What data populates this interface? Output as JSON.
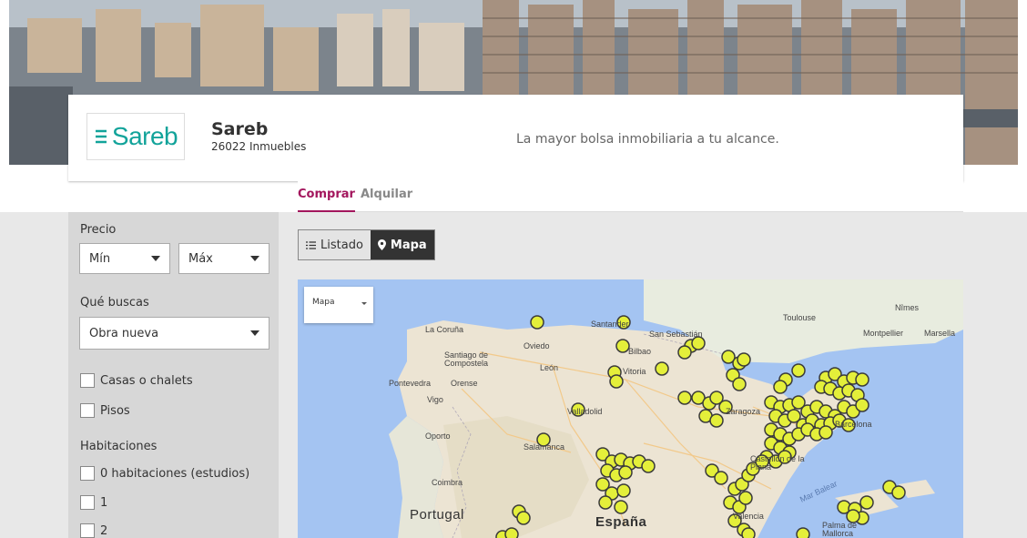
{
  "company": {
    "name": "Sareb",
    "count": "26022 Inmuebles",
    "tagline": "La mayor bolsa inmobiliaria a tu alcance.",
    "logo_text": "Sareb"
  },
  "tabs": {
    "buy": "Comprar",
    "rent": "Alquilar"
  },
  "filters": {
    "price_label": "Precio",
    "min": "Mín",
    "max": "Máx",
    "type_label": "Qué buscas",
    "type_value": "Obra nueva",
    "checks": [
      "Casas o chalets",
      "Pisos"
    ],
    "rooms_label": "Habitaciones",
    "rooms": [
      "0 habitaciones (estudios)",
      "1",
      "2"
    ]
  },
  "view": {
    "list": "Listado",
    "map": "Mapa"
  },
  "map": {
    "type_selector": "Mapa",
    "labels": {
      "la_coruna": "La Coruña",
      "oviedo": "Oviedo",
      "santander": "Santander",
      "bilbao": "Bilbao",
      "san_sebastian": "San Sebastián",
      "toulouse": "Toulouse",
      "nimes": "Nîmes",
      "montpellier": "Montpellier",
      "marseille": "Marsella",
      "santiago": "Santiago de Compostela",
      "leon": "León",
      "pontevedra": "Pontevedra",
      "orense": "Orense",
      "vigo": "Vigo",
      "vitoria": "Vitoria",
      "valladolid": "Valladolid",
      "zaragoza": "Zaragoza",
      "barcelona": "Barcelona",
      "oporto": "Oporto",
      "salamanca": "Salamanca",
      "coimbra": "Coimbra",
      "castellon": "Castellón de la Plana",
      "mar_balear": "Mar Balear",
      "portugal": "Portugal",
      "espana": "España",
      "valencia": "Valencia",
      "palma": "Palma de Mallorca"
    },
    "marker_color": "#e4ef3a"
  },
  "colors": {
    "accent": "#a3165d",
    "brand": "#12a39a"
  }
}
